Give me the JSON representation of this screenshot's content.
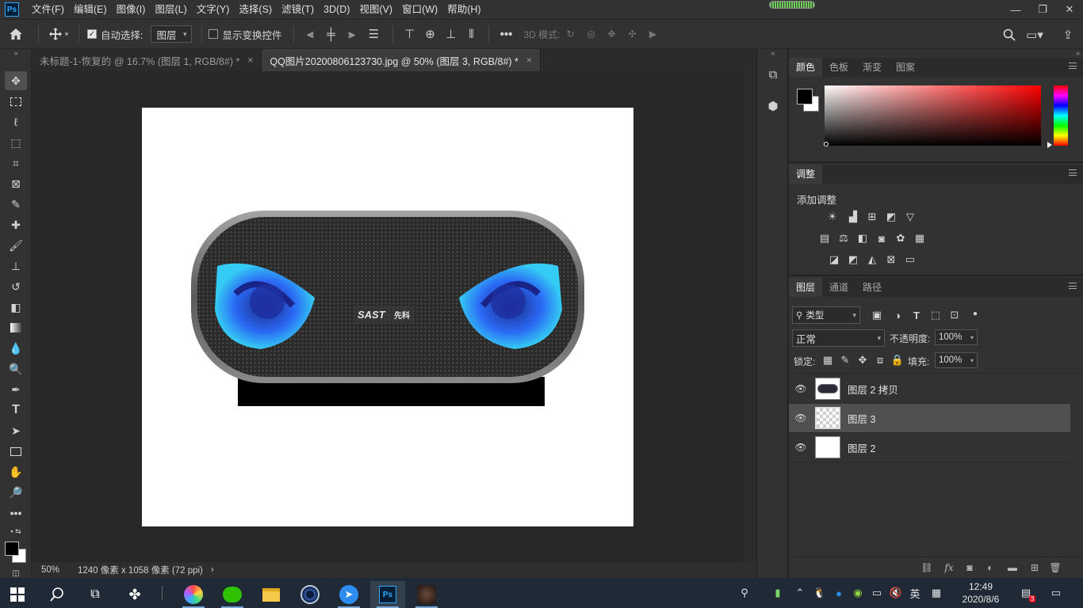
{
  "app": {
    "logo": "Ps"
  },
  "menu": [
    "文件(F)",
    "编辑(E)",
    "图像(I)",
    "图层(L)",
    "文字(Y)",
    "选择(S)",
    "滤镜(T)",
    "3D(D)",
    "视图(V)",
    "窗口(W)",
    "帮助(H)"
  ],
  "window_controls": {
    "minimize": "—",
    "restore": "❐",
    "close": "✕"
  },
  "options": {
    "auto_select_label": "自动选择:",
    "auto_select_checked": true,
    "target_select": "图层",
    "show_transform_label": "显示变换控件",
    "mode_3d_label": "3D 模式:"
  },
  "tabs": [
    {
      "title": "未标题-1-恢复的 @ 16.7% (图层 1, RGB/8#) *",
      "close": "×"
    },
    {
      "title": "QQ图片20200806123730.jpg @ 50% (图层 3, RGB/8#) *",
      "close": "×"
    }
  ],
  "document": {
    "logo_text": "SAST",
    "logo_cn": "先科",
    "colors": {
      "background": "#ffffff",
      "speaker_body": "#2b2b2b",
      "rim": "#8a8a8a",
      "eyes": "#2aa8ff",
      "black_bar": "#000000"
    }
  },
  "status": {
    "zoom": "50%",
    "doc_info": "1240 像素 x 1058 像素 (72 ppi)",
    "arrow": "›"
  },
  "color_panel": {
    "tabs": [
      "颜色",
      "色板",
      "渐变",
      "图案"
    ],
    "fg": "#000000",
    "bg": "#ffffff",
    "hue": "#ff0000"
  },
  "adjust_panel": {
    "tabs": [
      "调整"
    ],
    "add_label": "添加调整"
  },
  "layers_panel": {
    "tabs": [
      "图层",
      "通道",
      "路径"
    ],
    "filter": "类型",
    "blend_mode": "正常",
    "opacity_label": "不透明度:",
    "opacity": "100%",
    "lock_label": "锁定:",
    "fill_label": "填充:",
    "fill": "100%",
    "layers": [
      {
        "name": "图层 2 拷贝",
        "visible": true,
        "selected": false,
        "thumb": "speaker"
      },
      {
        "name": "图层 3",
        "visible": true,
        "selected": true,
        "thumb": "transparent"
      },
      {
        "name": "图层 2",
        "visible": true,
        "selected": false,
        "thumb": "white"
      }
    ]
  },
  "taskbar": {
    "time": "12:49",
    "date": "2020/8/6",
    "ime": "英",
    "notification_count": "3"
  }
}
